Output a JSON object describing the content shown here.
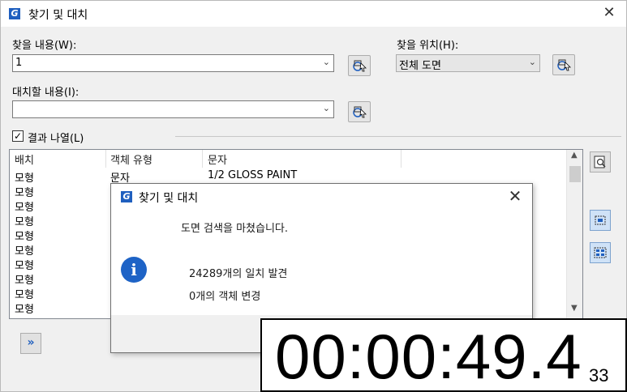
{
  "window": {
    "title": "찾기 및 대치",
    "app_icon": "gcad-logo-icon",
    "close_icon": "✕"
  },
  "find": {
    "label": "찾을 내용(W):",
    "value": "1"
  },
  "replace": {
    "label": "대치할 내용(I):",
    "value": ""
  },
  "find_where": {
    "label": "찾을 위치(H):",
    "value": "전체 도면"
  },
  "list_results": {
    "checkbox_label": "결과 나열(L)",
    "checked": true
  },
  "results_table": {
    "columns": [
      "배치",
      "객체 유형",
      "문자"
    ],
    "rows": [
      [
        "모형",
        "문자",
        "1/2 GLOSS PAINT"
      ],
      [
        "모형",
        "",
        ""
      ],
      [
        "모형",
        "",
        ""
      ],
      [
        "모형",
        "",
        ""
      ],
      [
        "모형",
        "",
        ""
      ],
      [
        "모형",
        "",
        ""
      ],
      [
        "모형",
        "",
        ""
      ],
      [
        "모형",
        "",
        ""
      ],
      [
        "모형",
        "",
        ""
      ],
      [
        "모형",
        "",
        ""
      ]
    ]
  },
  "dialog": {
    "title": "찾기 및 대치",
    "message": "도면 검색을 마쳤습니다.",
    "matches": "24289개의 일치 발견",
    "changed": "0개의 객체 변경",
    "icon": "info-icon"
  },
  "timer": {
    "main": "00:00:49.4",
    "fraction": "33"
  },
  "colors": {
    "accent": "#1f5fbf",
    "info": "#1e63c6"
  }
}
